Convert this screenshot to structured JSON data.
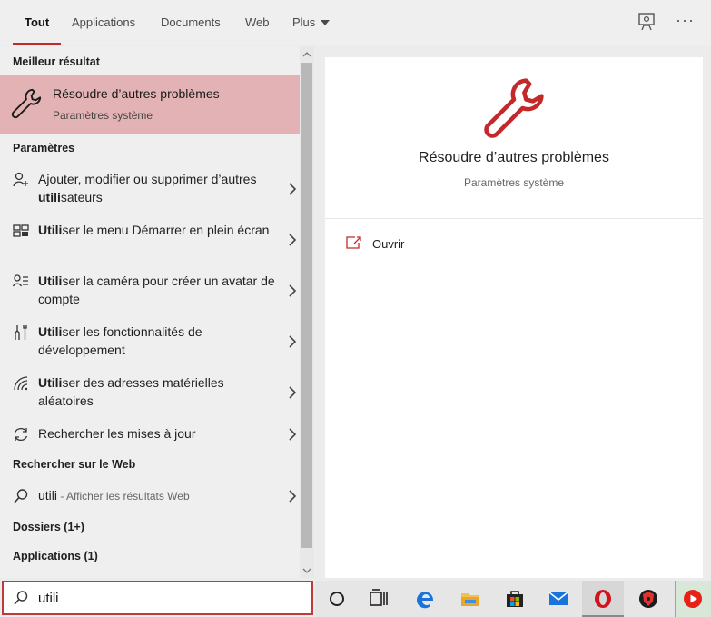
{
  "tabs": [
    {
      "label": "Tout",
      "active": true
    },
    {
      "label": "Applications"
    },
    {
      "label": "Documents"
    },
    {
      "label": "Web"
    },
    {
      "label": "Plus"
    }
  ],
  "top_icons": {
    "feedback": "feedback-icon",
    "more": "···"
  },
  "sections": {
    "best": "Meilleur résultat",
    "settings": "Paramètres",
    "web": "Rechercher sur le Web",
    "folders": "Dossiers (1+)",
    "apps": "Applications (1)"
  },
  "best_result": {
    "title": "Résoudre d’autres problèmes",
    "subtitle": "Paramètres système"
  },
  "settings_items": [
    {
      "icon": "add-user-icon",
      "pre": "Ajouter, modifier ou supprimer d’autres ",
      "bold": "utili",
      "post": "sateurs"
    },
    {
      "icon": "start-menu-icon",
      "pre": "",
      "bold": "Utili",
      "post": "ser le menu Démarrer en plein écran"
    },
    {
      "icon": "avatar-camera-icon",
      "pre": "",
      "bold": "Utili",
      "post": "ser la caméra pour créer un avatar de compte"
    },
    {
      "icon": "developer-tools-icon",
      "pre": "",
      "bold": "Utili",
      "post": "ser les fonctionnalités de développement"
    },
    {
      "icon": "wifi-icon",
      "pre": "",
      "bold": "Utili",
      "post": "ser des adresses matérielles aléatoires"
    },
    {
      "icon": "sync-icon",
      "pre": "Rechercher les mises à jour",
      "bold": "",
      "post": ""
    }
  ],
  "web_item": {
    "query": "utili",
    "suffix": " - Afficher les résultats Web"
  },
  "preview": {
    "title": "Résoudre d’autres problèmes",
    "subtitle": "Paramètres système",
    "open_label": "Ouvrir"
  },
  "search": {
    "value": "utili"
  },
  "taskbar": [
    "cortana-icon",
    "task-view-icon",
    "edge-icon",
    "file-explorer-icon",
    "store-icon",
    "mail-icon",
    "opera-icon",
    "brave-icon",
    "youtube-icon"
  ],
  "colors": {
    "accent": "#c4282a",
    "highlight": "#e3b2b4",
    "icon_red": "#c4282a"
  }
}
